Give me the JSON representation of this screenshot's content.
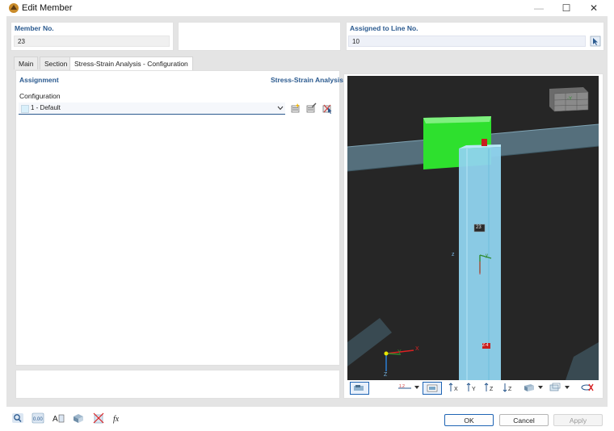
{
  "window": {
    "title": "Edit Member",
    "minimize_glyph": "—",
    "maximize_glyph": "☐",
    "close_glyph": "✕"
  },
  "header": {
    "member_no_label": "Member No.",
    "member_no_value": "23",
    "assigned_label": "Assigned to Line No.",
    "assigned_value": "10"
  },
  "tabs": [
    {
      "label": "Main",
      "active": false
    },
    {
      "label": "Section",
      "active": false
    },
    {
      "label": "Stress-Strain Analysis - Configuration",
      "active": true
    }
  ],
  "assignment": {
    "heading": "Assignment",
    "addon_name": "Stress-Strain Analysis",
    "configuration_label": "Configuration",
    "configuration_value": "1 - Default"
  },
  "viewport": {
    "member_label": "23",
    "node_top_label": "",
    "node_bottom_label": "Z-4",
    "axis_x": "X",
    "axis_y": "Y",
    "axis_z": "Z",
    "local_z": "z",
    "local_y": "y",
    "cube_label": "-Y"
  },
  "buttons": {
    "ok": "OK",
    "cancel": "Cancel",
    "apply": "Apply"
  },
  "colors": {
    "accent": "#1e64b4",
    "viewport_bg": "#262626",
    "member_cyan": "#8fd3ee",
    "support_green": "#2ee02e",
    "beam_gray": "#5e7d8c"
  }
}
